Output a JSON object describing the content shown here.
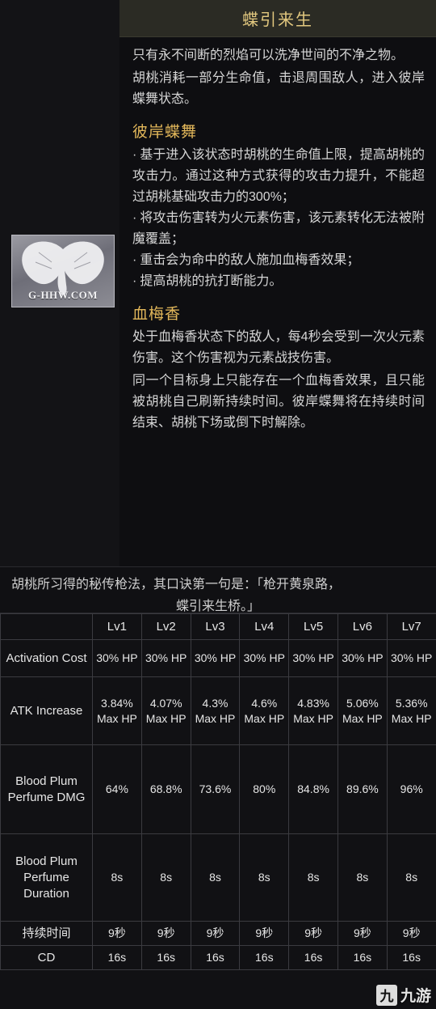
{
  "skill": {
    "title": "蝶引来生",
    "paragraphs": [
      "只有永不间断的烈焰可以洗净世间的不净之物。",
      "胡桃消耗一部分生命值，击退周围敌人，进入彼岸蝶舞状态。"
    ],
    "sections": [
      {
        "heading": "彼岸蝶舞",
        "bullets": [
          "基于进入该状态时胡桃的生命值上限，提高胡桃的攻击力。通过这种方式获得的攻击力提升，不能超过胡桃基础攻击力的300%；",
          "将攻击伤害转为火元素伤害，该元素转化无法被附魔覆盖；",
          "重击会为命中的敌人施加血梅香效果；",
          "提高胡桃的抗打断能力。"
        ]
      },
      {
        "heading": "血梅香",
        "paragraphs": [
          "处于血梅香状态下的敌人，每4秒会受到一次火元素伤害。这个伤害视为元素战技伤害。",
          "同一个目标身上只能存在一个血梅香效果，且只能被胡桃自己刷新持续时间。彼岸蝶舞将在持续时间结束、胡桃下场或倒下时解除。"
        ]
      }
    ]
  },
  "quote": {
    "line1": "胡桃所习得的秘传枪法，其口诀第一句是：「枪开黄泉路，",
    "line2": "蝶引来生桥。」"
  },
  "table": {
    "levels": [
      "Lv1",
      "Lv2",
      "Lv3",
      "Lv4",
      "Lv5",
      "Lv6",
      "Lv7"
    ],
    "corner": "",
    "rows": [
      {
        "label": "Activation Cost",
        "values": [
          "30% HP",
          "30% HP",
          "30% HP",
          "30% HP",
          "30% HP",
          "30% HP",
          "30% HP"
        ]
      },
      {
        "label": "ATK Increase",
        "values": [
          "3.84% Max HP",
          "4.07% Max HP",
          "4.3% Max HP",
          "4.6% Max HP",
          "4.83% Max HP",
          "5.06% Max HP",
          "5.36% Max HP"
        ]
      },
      {
        "label": "Blood Plum Perfume DMG",
        "values": [
          "64%",
          "68.8%",
          "73.6%",
          "80%",
          "84.8%",
          "89.6%",
          "96%"
        ]
      },
      {
        "label": "Blood Plum Perfume Duration",
        "values": [
          "8s",
          "8s",
          "8s",
          "8s",
          "8s",
          "8s",
          "8s"
        ]
      },
      {
        "label": "持续时间",
        "values": [
          "9秒",
          "9秒",
          "9秒",
          "9秒",
          "9秒",
          "9秒",
          "9秒"
        ]
      },
      {
        "label": "CD",
        "values": [
          "16s",
          "16s",
          "16s",
          "16s",
          "16s",
          "16s",
          "16s"
        ]
      }
    ]
  },
  "watermarks": {
    "art": "G-HHW.COM",
    "bottom_mark": "九",
    "bottom_text": "九游"
  }
}
